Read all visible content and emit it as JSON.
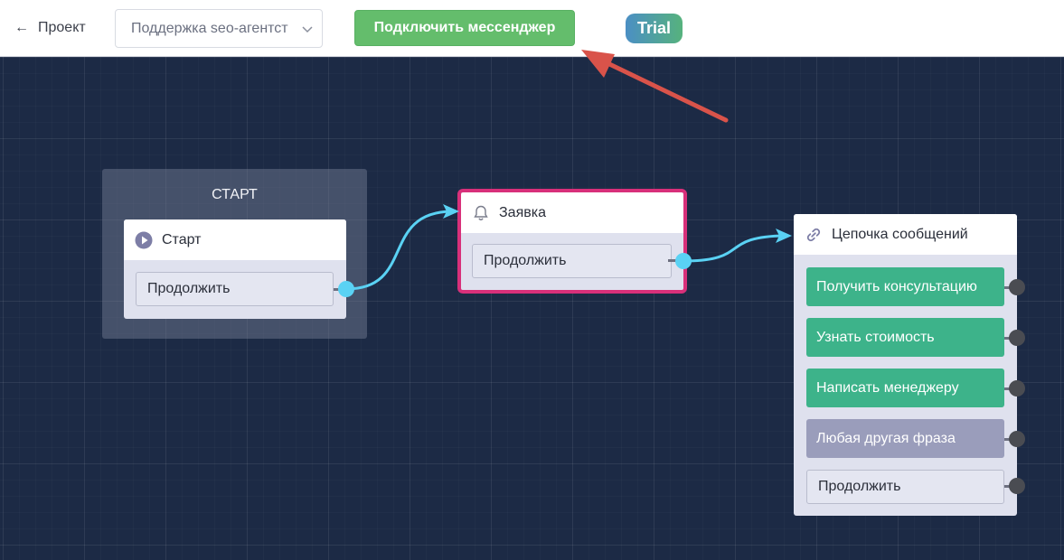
{
  "topbar": {
    "back_label": "Проект",
    "project_select_value": "Поддержка seo-агентст",
    "connect_button_label": "Подключить мессенджер",
    "trial_badge": "Trial"
  },
  "colors": {
    "connect_button": "#64bd6c",
    "trial_gradient_start": "#4b8fc4",
    "trial_gradient_end": "#56b27d",
    "canvas_background": "#1c2a45",
    "wire": "#5ad2f4",
    "selected_node_border": "#d8307a",
    "annotation_arrow": "#d9534a",
    "option_button": "#3db38a",
    "fallback_button": "#9a9dbb"
  },
  "canvas": {
    "group": {
      "title": "СТАРТ"
    },
    "start_node": {
      "title": "Старт",
      "icon": "play-circle-icon",
      "output_label": "Продолжить"
    },
    "request_node": {
      "title": "Заявка",
      "icon": "bell-icon",
      "output_label": "Продолжить",
      "selected": true
    },
    "chain_node": {
      "title": "Цепочка сообщений",
      "icon": "link-icon",
      "buttons": [
        {
          "label": "Получить консультацию",
          "kind": "option"
        },
        {
          "label": "Узнать стоимость",
          "kind": "option"
        },
        {
          "label": "Написать менеджеру",
          "kind": "option"
        },
        {
          "label": "Любая другая фраза",
          "kind": "fallback"
        }
      ],
      "output_label": "Продолжить"
    }
  }
}
